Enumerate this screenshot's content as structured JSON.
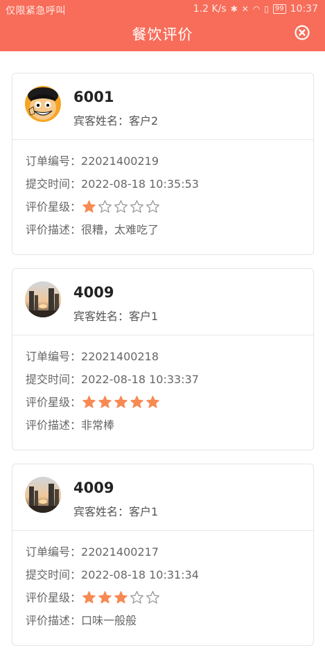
{
  "status_bar": {
    "carrier": "仅限紧急呼叫",
    "speed": "1.2 K/s",
    "battery": "99",
    "time": "10:37"
  },
  "header": {
    "title": "餐饮评价",
    "close_icon": "close-circle-icon"
  },
  "colors": {
    "brand": "#f76d5a",
    "star_filled": "#f78a52",
    "star_empty_stroke": "#999999"
  },
  "labels": {
    "guest_prefix": "宾客姓名：",
    "order_no": "订单编号：",
    "submit_time": "提交时间：",
    "rating": "评价星级：",
    "description": "评价描述："
  },
  "reviews": [
    {
      "room": "6001",
      "guest_name": "客户2",
      "order_no": "22021400219",
      "submit_time": "2022-08-18 10:35:53",
      "rating": 1,
      "description": "很糟，太难吃了",
      "avatar": "cartoon-avatar"
    },
    {
      "room": "4009",
      "guest_name": "客户1",
      "order_no": "22021400218",
      "submit_time": "2022-08-18 10:33:37",
      "rating": 5,
      "description": "非常棒",
      "avatar": "city-avatar"
    },
    {
      "room": "4009",
      "guest_name": "客户1",
      "order_no": "22021400217",
      "submit_time": "2022-08-18 10:31:34",
      "rating": 3,
      "description": "口味一般般",
      "avatar": "city-avatar"
    }
  ]
}
